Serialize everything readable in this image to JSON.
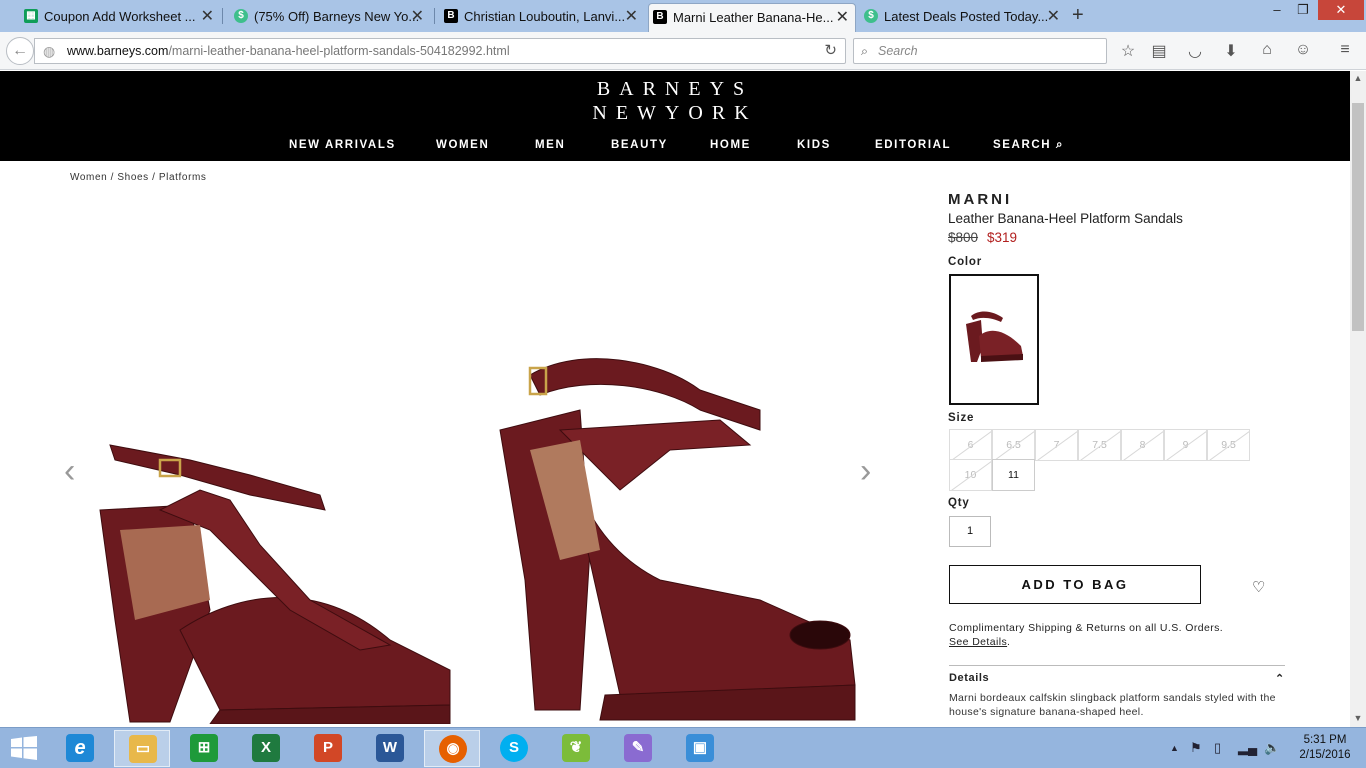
{
  "browser": {
    "tabs": [
      {
        "title": "Coupon Add Worksheet ...",
        "icon": "sheets-icon",
        "color": "#0f9d58",
        "glyph": "▦",
        "active": false
      },
      {
        "title": "(75% Off) Barneys New Yo...",
        "icon": "dollar-shield-icon",
        "color": "#3ebf8c",
        "glyph": "$",
        "active": false
      },
      {
        "title": "Christian Louboutin, Lanvi...",
        "icon": "barneys-b-icon",
        "color": "#000000",
        "glyph": "B",
        "active": false
      },
      {
        "title": "Marni Leather Banana-He...",
        "icon": "barneys-b-icon",
        "color": "#000000",
        "glyph": "B",
        "active": true
      },
      {
        "title": "Latest Deals Posted Today...",
        "icon": "dollar-shield-icon",
        "color": "#3ebf8c",
        "glyph": "$",
        "active": false
      }
    ],
    "url_host": "www.barneys.com",
    "url_path": "/marni-leather-banana-heel-platform-sandals-504182992.html",
    "search_placeholder": "Search"
  },
  "site": {
    "logo_line1": "BARNEYS",
    "logo_line2": "NEWYORK",
    "nav": [
      "NEW ARRIVALS",
      "WOMEN",
      "MEN",
      "BEAUTY",
      "HOME",
      "KIDS",
      "EDITORIAL",
      "SEARCH"
    ]
  },
  "breadcrumb": "Women / Shoes / Platforms",
  "product": {
    "designer": "MARNI",
    "name": "Leather Banana-Heel Platform Sandals",
    "price_was": "$800",
    "price_now": "$319",
    "color_label": "Color",
    "size_label": "Size",
    "sizes": [
      {
        "label": "6",
        "available": false
      },
      {
        "label": "6.5",
        "available": false
      },
      {
        "label": "7",
        "available": false
      },
      {
        "label": "7.5",
        "available": false
      },
      {
        "label": "8",
        "available": false
      },
      {
        "label": "9",
        "available": false
      },
      {
        "label": "9.5",
        "available": false
      },
      {
        "label": "10",
        "available": false
      },
      {
        "label": "11",
        "available": true
      }
    ],
    "qty_label": "Qty",
    "qty_value": "1",
    "add_to_bag": "ADD TO BAG",
    "shipping_note": "Complimentary Shipping & Returns on all U.S. Orders.",
    "see_details": "See Details",
    "details_label": "Details",
    "description": "Marni bordeaux calfskin slingback platform sandals styled with the house's signature banana-shaped heel.",
    "color_swatch": "#6b1a1f"
  },
  "taskbar": {
    "apps": [
      {
        "name": "internet-explorer-icon",
        "color": "#1e88d6",
        "glyph": "e"
      },
      {
        "name": "file-explorer-icon",
        "color": "#e8b84a",
        "glyph": "▭"
      },
      {
        "name": "store-icon",
        "color": "#1e9a3a",
        "glyph": "⊞"
      },
      {
        "name": "excel-icon",
        "color": "#1f7a3f",
        "glyph": "X"
      },
      {
        "name": "powerpoint-icon",
        "color": "#d24726",
        "glyph": "P"
      },
      {
        "name": "word-icon",
        "color": "#2b5797",
        "glyph": "W"
      },
      {
        "name": "firefox-icon",
        "color": "#e66000",
        "glyph": "◉"
      },
      {
        "name": "skype-icon",
        "color": "#00aff0",
        "glyph": "S"
      },
      {
        "name": "feather-app-icon",
        "color": "#7cbc3a",
        "glyph": "❦"
      },
      {
        "name": "paint-icon",
        "color": "#8a6bd1",
        "glyph": "✎"
      },
      {
        "name": "photos-icon",
        "color": "#3a8ed8",
        "glyph": "▣"
      }
    ],
    "time": "5:31 PM",
    "date": "2/15/2016"
  }
}
